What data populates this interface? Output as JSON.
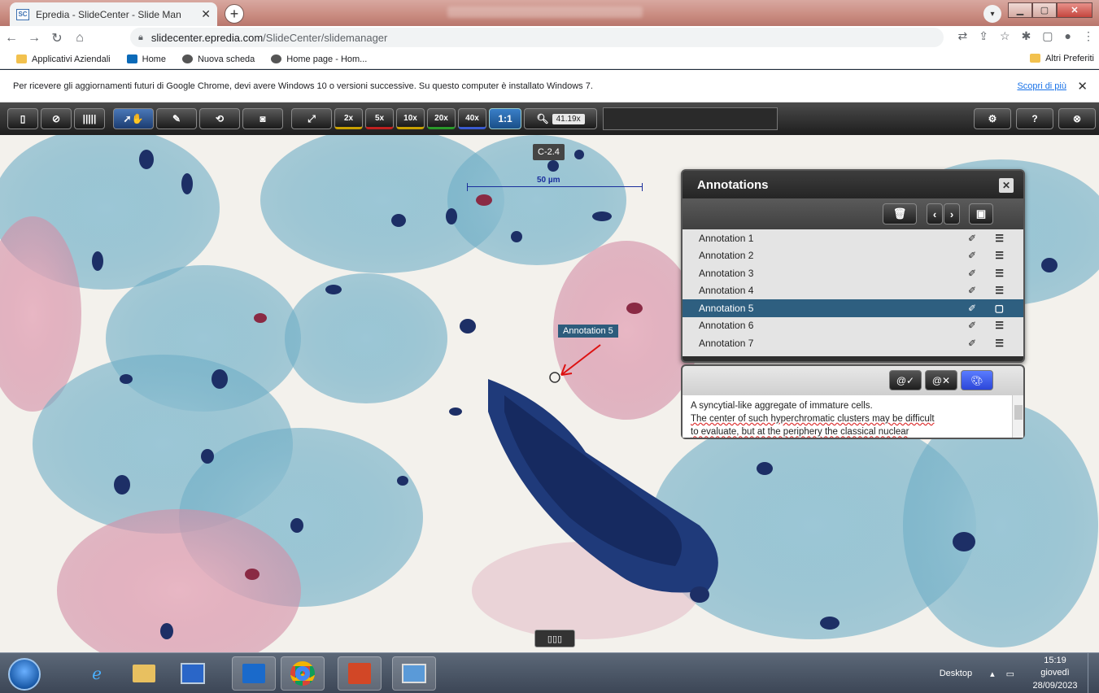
{
  "browser": {
    "tab_title": "Epredia - SlideCenter - Slide Man",
    "tab_favicon": "SC",
    "url_domain": "slidecenter.epredia.com",
    "url_path": "/SlideCenter/slidemanager",
    "bookmarks": [
      "Applicativi Aziendali",
      "Home",
      "Nuova scheda",
      "Home page - Hom..."
    ],
    "bookmark_right": "Altri Preferiti",
    "info_message": "Per ricevere gli aggiornamenti futuri di Google Chrome, devi avere Windows 10 o versioni successive. Su questo computer è installato Windows 7.",
    "info_link": "Scopri di più"
  },
  "viewer_toolbar": {
    "magnifications": [
      "2x",
      "5x",
      "10x",
      "20x",
      "40x"
    ],
    "one_to_one": "1:1",
    "zoom_value": "41.19x"
  },
  "slide": {
    "label": "C-2.4",
    "scale_label": "50 µm",
    "annotation_tag": "Annotation 5"
  },
  "annotations_panel": {
    "title": "Annotations",
    "items": [
      "Annotation 1",
      "Annotation 2",
      "Annotation 3",
      "Annotation 4",
      "Annotation 5",
      "Annotation 6",
      "Annotation 7"
    ],
    "selected_index": 4
  },
  "description": {
    "line1": "A syncytial-like aggregate of immature cells.",
    "line2": "The center of such hyperchromatic clusters may be difficult",
    "line3": "to evaluate, but at the periphery the classical nuclear"
  },
  "taskbar": {
    "desktop_label": "Desktop",
    "time": "15:19",
    "day": "giovedì",
    "date": "28/09/2023"
  }
}
